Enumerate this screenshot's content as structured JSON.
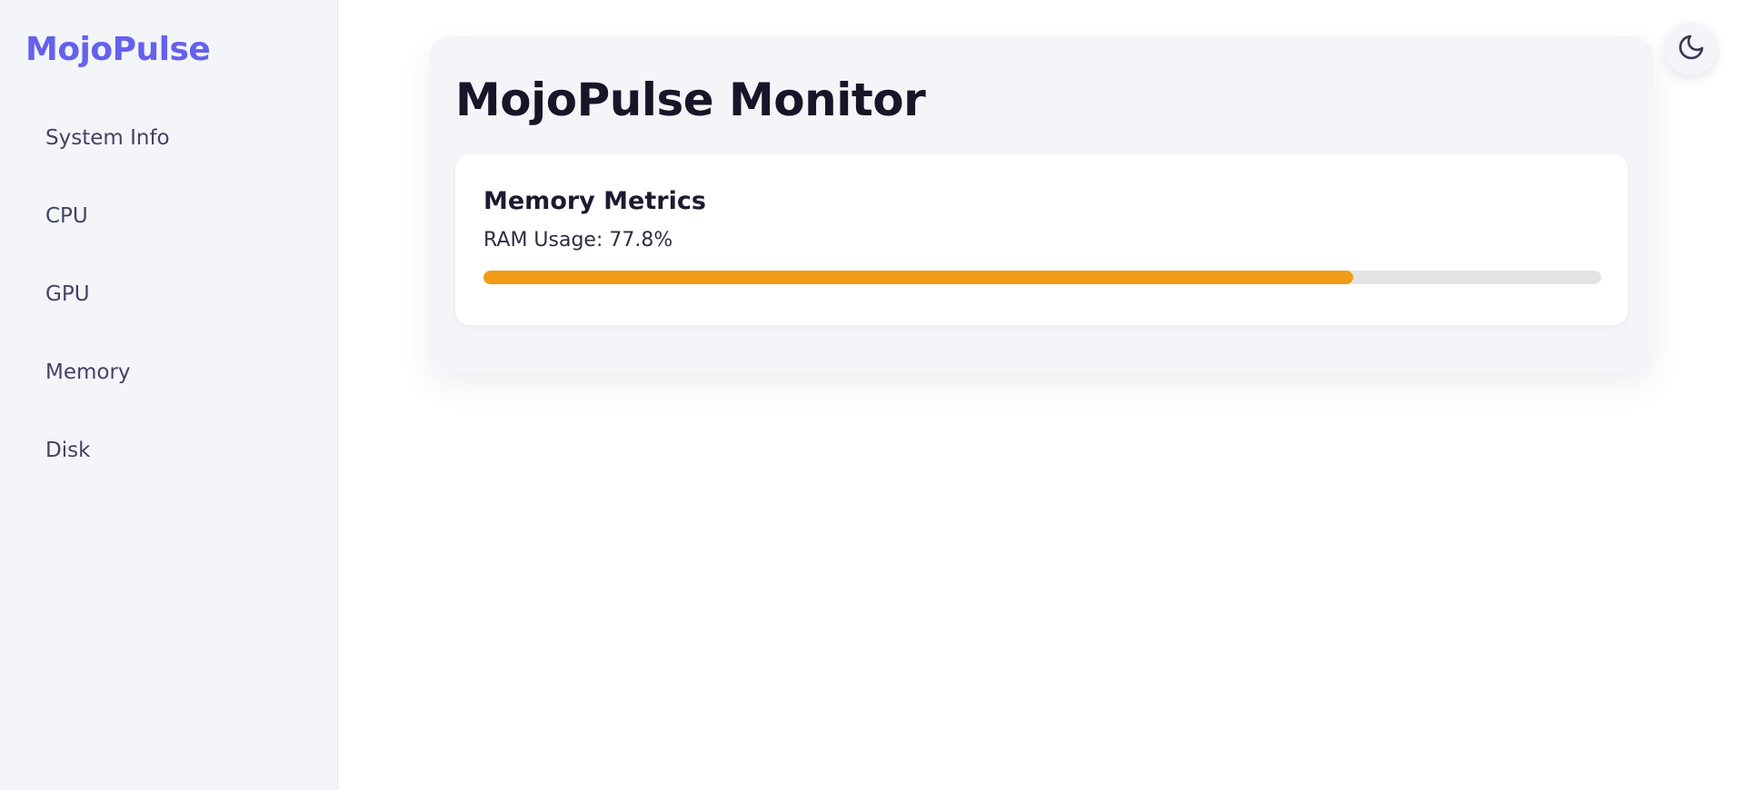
{
  "brand": {
    "name": "MojoPulse",
    "color": "#6461ee"
  },
  "sidebar": {
    "items": [
      {
        "label": "System Info"
      },
      {
        "label": "CPU"
      },
      {
        "label": "GPU"
      },
      {
        "label": "Memory"
      },
      {
        "label": "Disk"
      }
    ]
  },
  "main": {
    "title": "MojoPulse Monitor",
    "card": {
      "title": "Memory Metrics",
      "usage_text": "RAM Usage: 77.8%",
      "usage_percent": 77.8,
      "bar_color": "#f09c14",
      "track_color": "#e4e4e4"
    }
  },
  "theme_toggle": {
    "icon": "moon-icon"
  }
}
